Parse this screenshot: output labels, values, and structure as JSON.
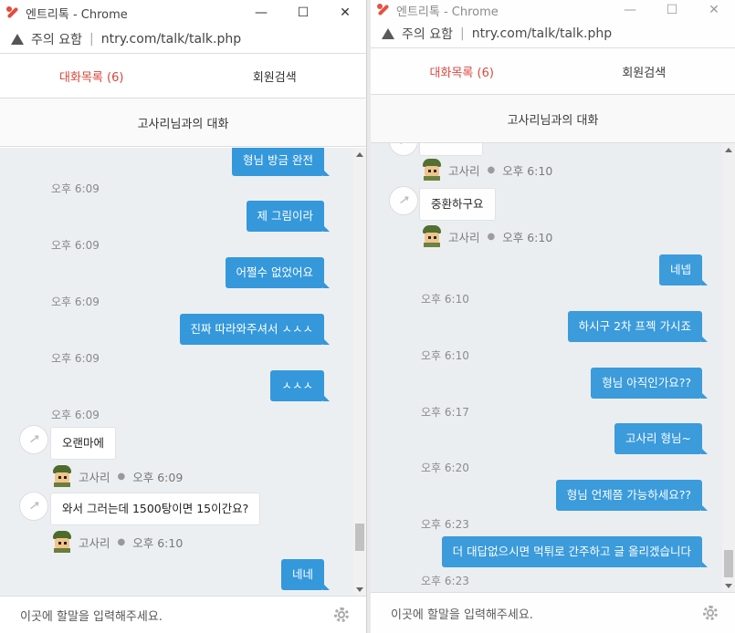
{
  "window1": {
    "title": "엔트리톡 - Chrome",
    "address": {
      "warning": "주의 요함",
      "url": "ntry.com/talk/talk.php"
    },
    "tabs": [
      "대화목록 (6)",
      "회원검색"
    ],
    "conversation_title": "고사리님과의 대화",
    "input_placeholder": "이곳에 할말을 입력해주세요.",
    "messages": [
      {
        "side": "out",
        "text": "형님 방금 완전",
        "time": "오후 6:09"
      },
      {
        "side": "out",
        "text": "제 그림이라",
        "time": "오후 6:09"
      },
      {
        "side": "out",
        "text": "어쩔수 없었어요",
        "time": "오후 6:09"
      },
      {
        "side": "out",
        "text": "진짜 따라와주셔서 ㅅㅅㅅ",
        "time": "오후 6:09"
      },
      {
        "side": "out",
        "text": "ㅅㅅㅅ",
        "time": "오후 6:09"
      },
      {
        "side": "in",
        "text": "오랜마에",
        "sender": "고사리",
        "time": "오후 6:09"
      },
      {
        "side": "in",
        "text": "와서 그러는데 1500탕이면 15이간요?",
        "sender": "고사리",
        "time": "오후 6:10"
      },
      {
        "side": "out",
        "text": "네네"
      }
    ]
  },
  "window2": {
    "title": "엔트리톡 - Chrome",
    "address": {
      "warning": "주의 요함",
      "url": "ntry.com/talk/talk.php"
    },
    "tabs": [
      "대화목록 (6)",
      "회원검색"
    ],
    "conversation_title": "고사리님과의 대화",
    "input_placeholder": "이곳에 할말을 입력해주세요.",
    "messages": [
      {
        "side": "in",
        "text": "",
        "sender": "고사리",
        "time": "오후 6:10"
      },
      {
        "side": "in",
        "text": "중환하구요",
        "sender": "고사리",
        "time": "오후 6:10"
      },
      {
        "side": "out",
        "text": "네넵",
        "time": "오후 6:10"
      },
      {
        "side": "out",
        "text": "하시구 2차 프젝 가시죠",
        "time": "오후 6:10"
      },
      {
        "side": "out",
        "text": "형님 아직인가요??",
        "time": "오후 6:17"
      },
      {
        "side": "out",
        "text": "고사리 형님~",
        "time": "오후 6:20"
      },
      {
        "side": "out",
        "text": "형님 언제쯤 가능하세요??",
        "time": "오후 6:23"
      },
      {
        "side": "out",
        "text": "더 대답없으시면 먹튀로 간주하고 글 올리겠습니다",
        "time": "오후 6:23"
      }
    ]
  },
  "colors": {
    "accent": "#3498db",
    "active_tab": "#d9443a",
    "chat_bg": "#eceff2"
  },
  "icons": [
    "app-logo-icon",
    "warning-icon",
    "gear-icon",
    "minimize-icon",
    "maximize-icon",
    "close-icon",
    "avatar-placeholder-icon",
    "user-avatar-icon"
  ]
}
